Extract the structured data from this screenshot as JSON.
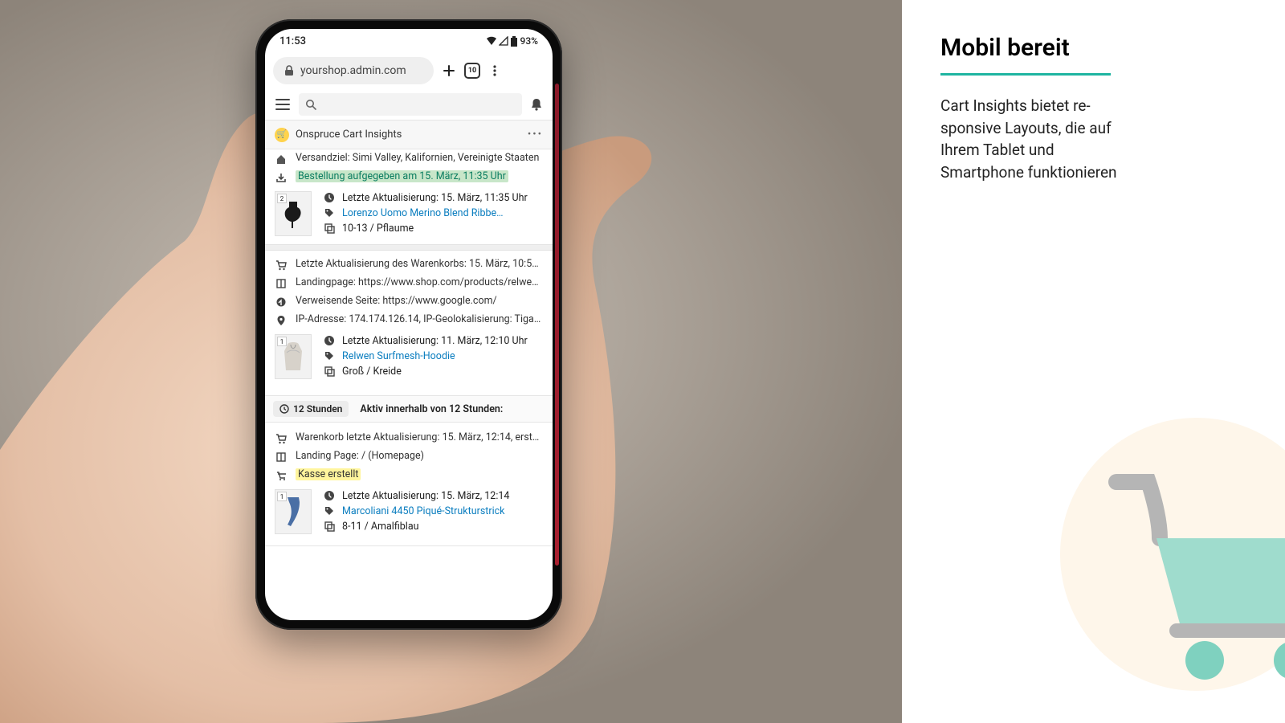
{
  "status": {
    "time": "11:53",
    "battery": "93%"
  },
  "browser": {
    "url": "yourshop.admin.com",
    "tab_count": "10"
  },
  "app": {
    "title": "Onspruce Cart Insights",
    "shipping": "Versandziel: Simi Valley, Kalifornien, Vereinigte Staaten",
    "order_placed": "Bestellung aufgegeben am 15. März, 11:35 Uhr"
  },
  "product1": {
    "qty": "2",
    "last_update": "Letzte Aktualisierung: 15. März, 11:35 Uhr",
    "name": "Lorenzo Uomo Merino Blend Ribbe…",
    "variant": "10-13 / Pflaume"
  },
  "cart_meta": {
    "last_update": "Letzte Aktualisierung des Warenkorbs: 15. März, 10:52 …",
    "landing": "Landingpage: https://www.shop.com/products/relwen-…",
    "referrer": "Verweisende Seite: https://www.google.com/",
    "ip": "IP-Adresse: 174.174.126.14, IP-Geolokalisierung: Tigard,…"
  },
  "product2": {
    "qty": "1",
    "last_update": "Letzte Aktualisierung: 11. März, 12:10 Uhr",
    "name": "Relwen Surfmesh-Hoodie",
    "variant": "Groß / Kreide"
  },
  "time_section": {
    "chip": "12 Stunden",
    "label": "Aktiv innerhalb von 12 Stunden:"
  },
  "cart2_meta": {
    "last_update": "Warenkorb letzte Aktualisierung: 15. März, 12:14, erstellt:…",
    "landing": "Landing Page: / (Homepage)",
    "checkout": "Kasse erstellt"
  },
  "product3": {
    "qty": "1",
    "last_update": "Letzte Aktualisierung: 15. März, 12:14",
    "name": "Marcoliani 4450 Piqué-Strukturstrick",
    "variant": "8-11 / Amalfiblau"
  },
  "side": {
    "heading": "Mobil bereit",
    "body": "Cart Insights bietet re­sponsive Layouts, die auf Ihrem Tablet und Smartphone funktion­ieren"
  }
}
